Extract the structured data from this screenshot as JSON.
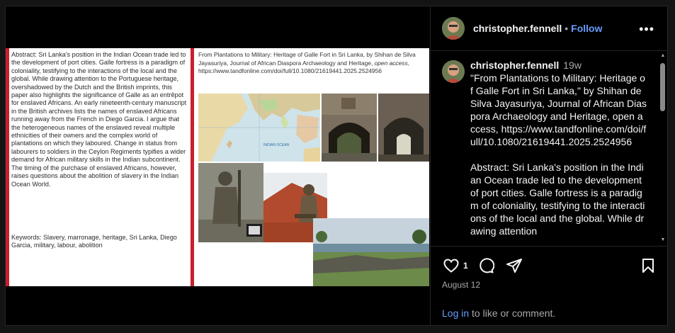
{
  "post": {
    "slide": {
      "abstract": "Abstract: Sri Lanka's position in the Indian Ocean trade led to the development of port cities. Galle fortress is a paradigm of coloniality, testifying to the interactions of the local and the global. While drawing attention to the Portuguese heritage, overshadowed by the Dutch and the British imprints, this paper also highlights the significance of Galle as an entrêpot for enslaved Africans. An early nineteenth-century manuscript in the British archives lists the names of enslaved Africans running away from the French in Diego Garcia. I argue that the heterogeneous names of the enslaved reveal multiple ethnicities of their owners and the complex world of plantations on which they laboured. Change in status from labourers to soldiers in the Ceylon Regiments typifies a wider demand for African military skills in the Indian subcontinent. The timing of the purchase of enslaved Africans, however, raises questions about the abolition of slavery in the Indian Ocean World.",
      "keywords": "Keywords: Slavery, marronage, heritage, Sri Lanka, Diego Garcia, military, labour, abolition",
      "citation_main": "From Plantations to Military: Heritage of Galle Fort in Sri Lanka, by Shihan de Silva Jayasuriya, Journal of African Diaspora Archaeology and Heritage, ",
      "citation_italic": "open access",
      "citation_url": ", https://www.tandfonline.com/doi/full/10.1080/21619441.2025.2524956",
      "map_label": "INDIAN OCEAN"
    },
    "header": {
      "username": "christopher.fennell",
      "separator": "•",
      "follow_label": "Follow",
      "more_label": "•••"
    },
    "caption": {
      "username": "christopher.fennell",
      "age": "19w",
      "text": "\"From Plantations to Military: Heritage of Galle Fort in Sri Lanka,\" by Shihan de Silva Jayasuriya, Journal of African Diaspora Archaeology and Heritage, open access, https://www.tandfonline.com/doi/full/10.1080/21619441.2025.2524956\n\nAbstract: Sri Lanka's position in the Indian Ocean trade led to the development of port cities. Galle fortress is a paradigm of coloniality, testifying to the interactions of the local and the global. While drawing attention"
    },
    "actions": {
      "like_count": "1",
      "date": "August 12",
      "login_link": "Log in",
      "login_rest": " to like or comment."
    },
    "colors": {
      "accent": "#6a9cff",
      "slide_border_red": "#c8202f",
      "background": "#000000"
    },
    "icons": [
      "heart-icon",
      "comment-icon",
      "share-icon",
      "bookmark-icon",
      "more-options-icon"
    ]
  }
}
